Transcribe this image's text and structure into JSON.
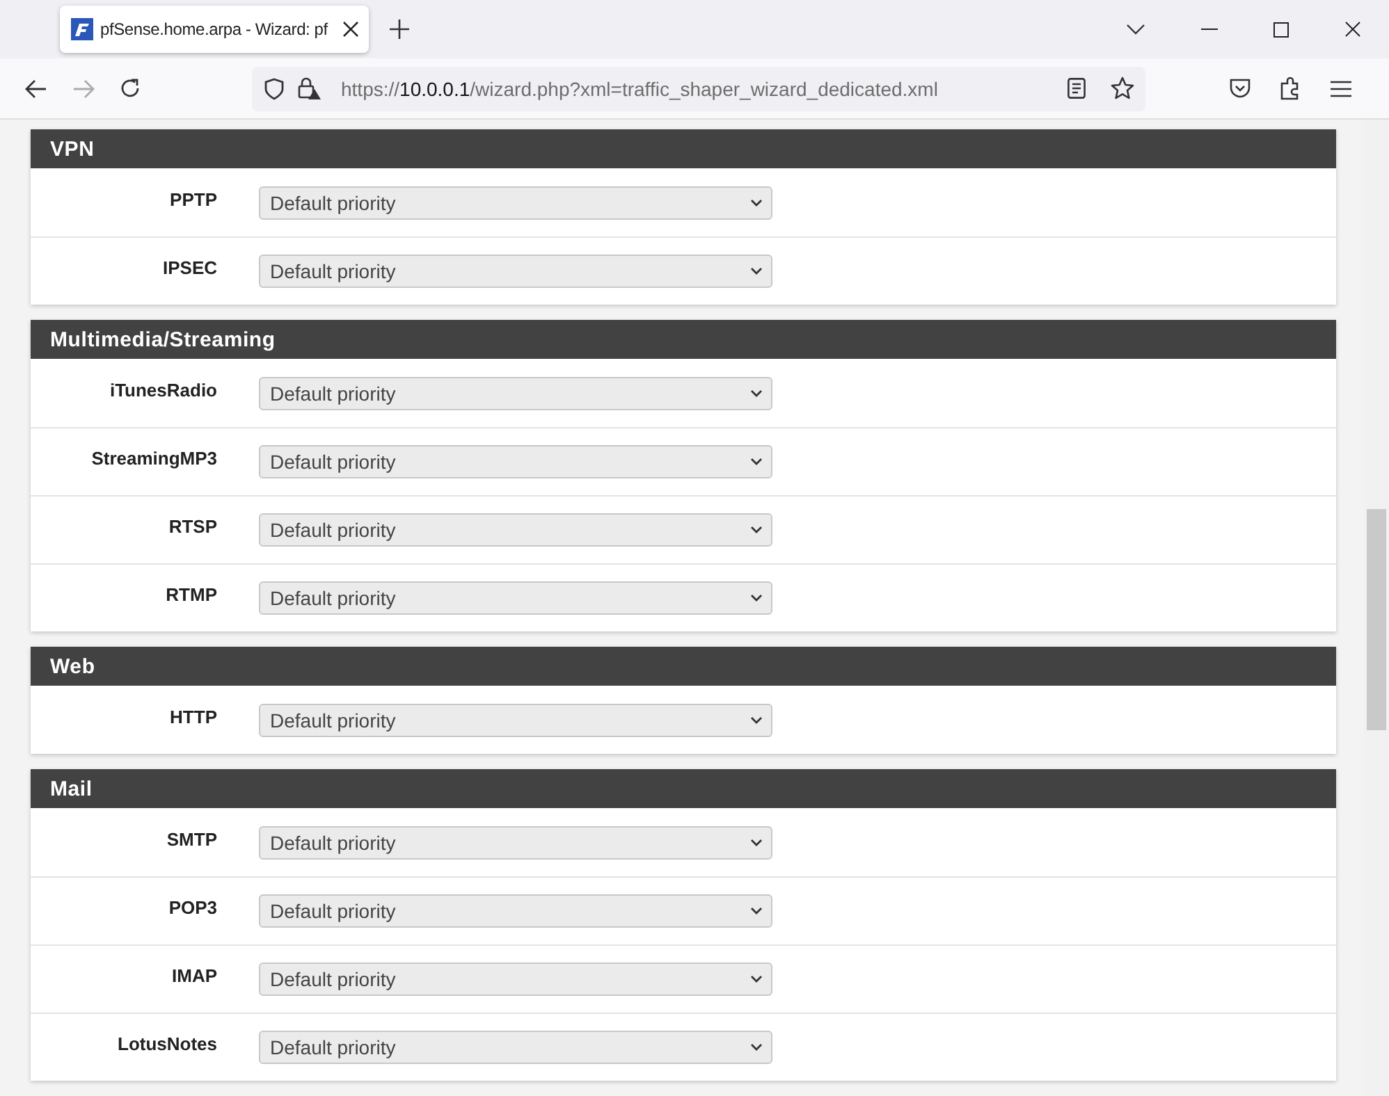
{
  "browser": {
    "tab": {
      "title": "pfSense.home.arpa - Wizard: pf",
      "selected": true
    },
    "url": {
      "scheme": "https://",
      "host": "10.0.0.1",
      "path": "/wizard.php?xml=traffic_shaper_wizard_dedicated.xml"
    }
  },
  "sections": [
    {
      "title": "VPN",
      "rows": [
        {
          "label": "PPTP",
          "value": "Default priority"
        },
        {
          "label": "IPSEC",
          "value": "Default priority"
        }
      ]
    },
    {
      "title": "Multimedia/Streaming",
      "rows": [
        {
          "label": "iTunesRadio",
          "value": "Default priority"
        },
        {
          "label": "StreamingMP3",
          "value": "Default priority"
        },
        {
          "label": "RTSP",
          "value": "Default priority"
        },
        {
          "label": "RTMP",
          "value": "Default priority"
        }
      ]
    },
    {
      "title": "Web",
      "rows": [
        {
          "label": "HTTP",
          "value": "Default priority"
        }
      ]
    },
    {
      "title": "Mail",
      "rows": [
        {
          "label": "SMTP",
          "value": "Default priority"
        },
        {
          "label": "POP3",
          "value": "Default priority"
        },
        {
          "label": "IMAP",
          "value": "Default priority"
        },
        {
          "label": "LotusNotes",
          "value": "Default priority"
        }
      ]
    }
  ]
}
